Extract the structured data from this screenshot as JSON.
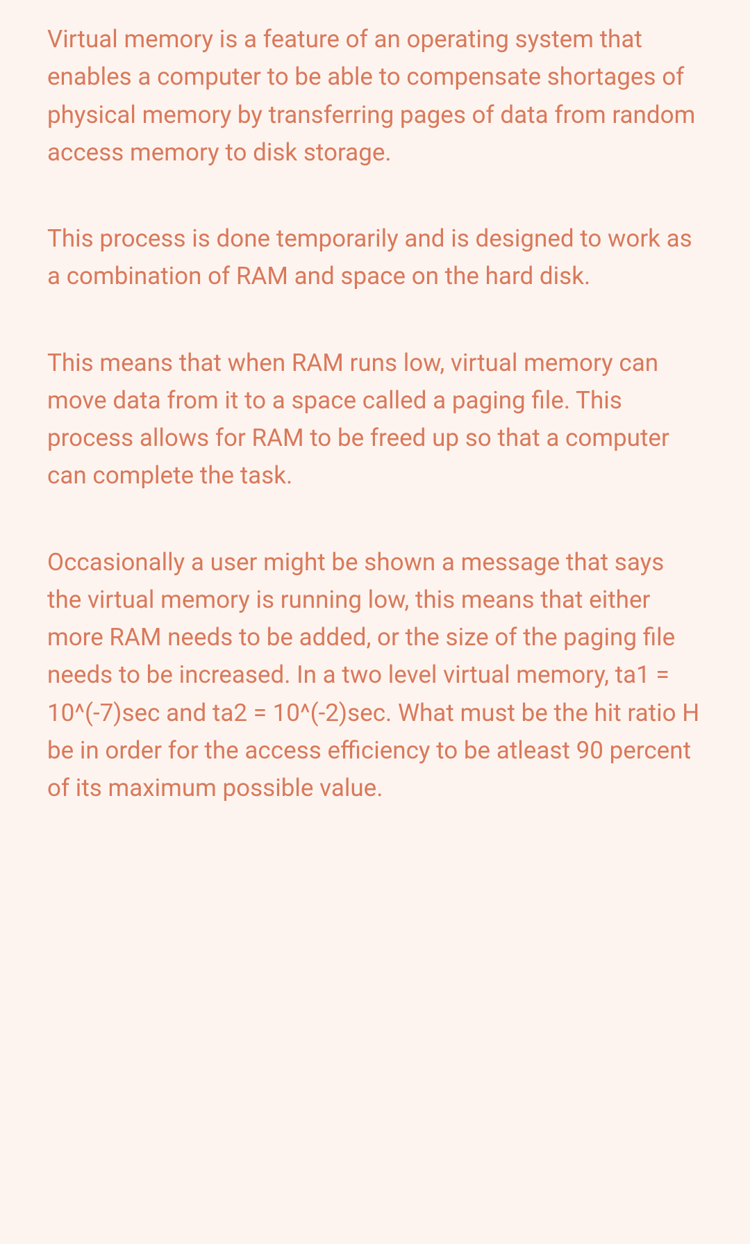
{
  "paragraphs": [
    "Virtual memory is a feature of an operating system that enables a computer to be able to compensate shortages of physical memory by transferring pages of data from random access memory to disk storage.",
    "This process is done temporarily and is designed to work as a combination of RAM and space on the hard disk.",
    "This means that when RAM runs low, virtual memory can move data from it to a space called a paging file. This process allows for RAM to be freed up so that a computer can complete the task.",
    "Occasionally a user might be shown a message that says the virtual memory is running low, this means that either more RAM needs to be added, or the size of the paging file needs to be increased. In a two level virtual memory, ta1 = 10^(-7)sec and ta2 = 10^(-2)sec. What must be the hit ratio H be in order for the access efficiency to be atleast 90 percent of its maximum possible value."
  ]
}
